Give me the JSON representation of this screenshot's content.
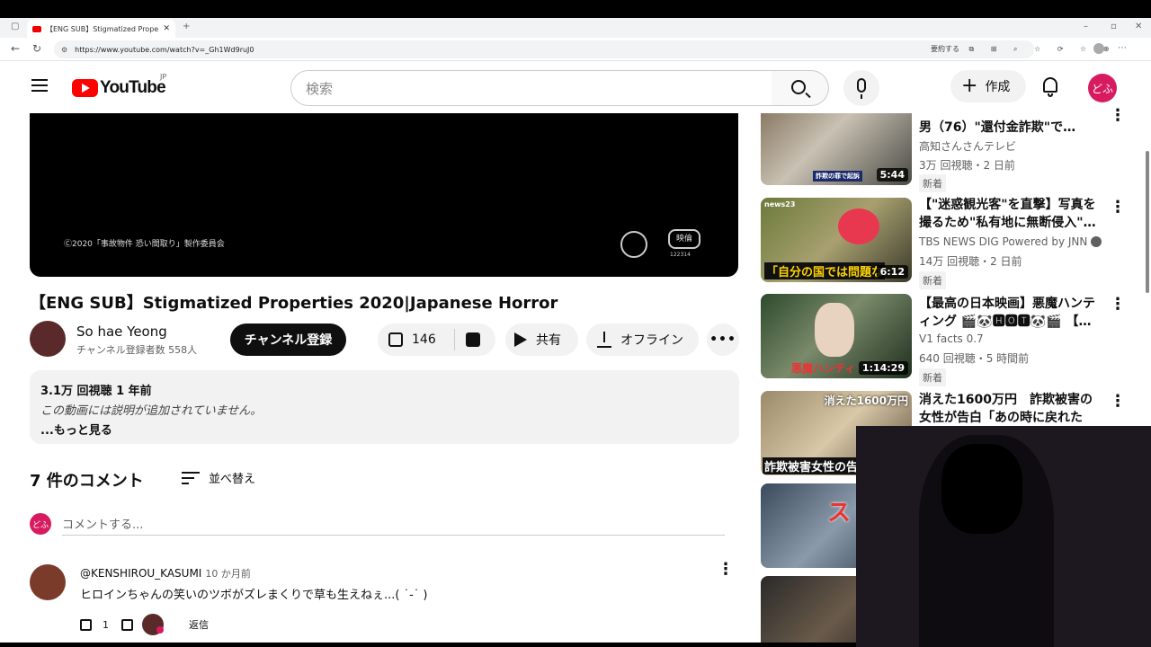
{
  "browser": {
    "tab_title": "【ENG SUB】Stigmatized Properties",
    "url": "https://www.youtube.com/watch?v=_Gh1Wd9ruJ0",
    "toolbar_text": "要約する"
  },
  "header": {
    "logo_text": "YouTube",
    "country_code": "JP",
    "search_placeholder": "検索",
    "create_label": "作成",
    "avatar_text": "どふ"
  },
  "video": {
    "copyright_overlay": "Ⓒ2020「事故物件 恐い間取り」製作委員会",
    "rating_mark": "映倫",
    "rating_number": "122314",
    "title": "【ENG SUB】Stigmatized Properties 2020|Japanese Horror",
    "channel_name": "So hae Yeong",
    "subscribers": "チャンネル登録者数 558人",
    "subscribe_label": "チャンネル登録",
    "likes": "146",
    "share_label": "共有",
    "download_label": "オフライン",
    "more_label": "•••"
  },
  "description": {
    "stats": "3.1万 回視聴  1 年前",
    "body": "この動画には説明が追加されていません。",
    "more": "...もっと見る"
  },
  "comments": {
    "count_label": "7 件のコメント",
    "sort_label": "並べ替え",
    "my_avatar": "どふ",
    "input_placeholder": "コメントする...",
    "items": [
      {
        "author": "@KENSHIROU_KASUMI",
        "time": "10 か月前",
        "text": "ヒロインちゃんの笑いのツボがズレまくりで草も生えねぇ...( ˙-˙ )",
        "likes": "1",
        "reply_label": "返信"
      }
    ]
  },
  "related": [
    {
      "title": "男（76）\"還付金詐欺\"で…『e-...",
      "channel": "高知さんさんテレビ",
      "meta": "3万 回視聴・2 日前",
      "badge": "新着",
      "duration": "5:44",
      "thumb_caption": "詐欺の罪で起訴"
    },
    {
      "title": "【\"迷惑観光客\"を直撃】写真を撮るため\"私有地に無断侵入\"…",
      "channel": "TBS NEWS DIG Powered by JNN",
      "meta": "14万 回視聴・2 日前",
      "badge": "新着",
      "duration": "6:12",
      "thumb_caption": "「自分の国では問題な",
      "thumb_tag": "news23"
    },
    {
      "title": "【最高の日本映画】悪魔ハンティング 🎬🐼🅷🅾🆃🐼🎬 【…",
      "channel": "V1 facts 0.7",
      "meta": "640 回視聴・5 時間前",
      "badge": "新着",
      "duration": "1:14:29",
      "thumb_caption": "悪魔ハンティ"
    },
    {
      "title": "消えた1600万円　詐欺被害の女性が告白「あの時に戻れたら」…",
      "thumb_caption": "消えた1600万円",
      "thumb_caption2": "詐欺被害女性の告"
    },
    {
      "thumb_caption": "スト"
    }
  ]
}
